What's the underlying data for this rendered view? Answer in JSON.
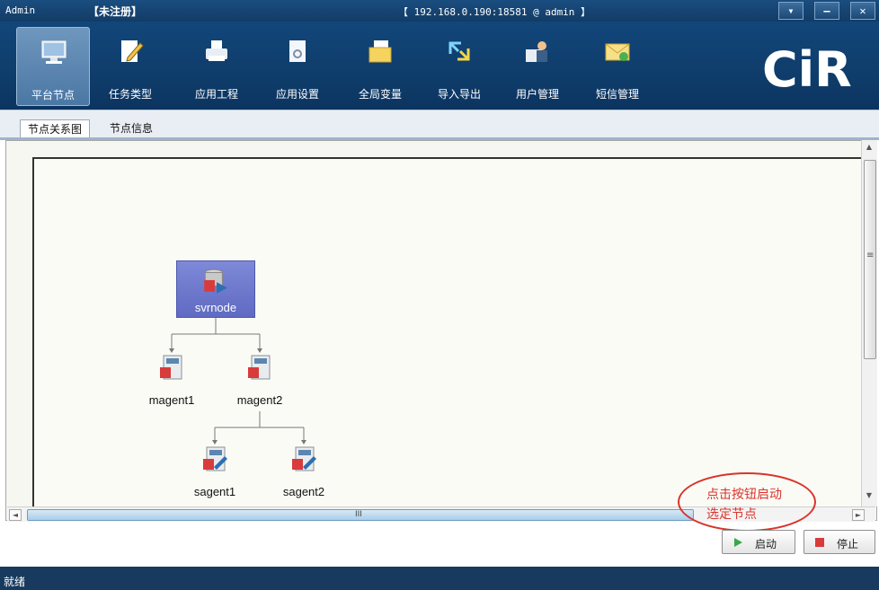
{
  "titlebar": {
    "user": "Admin",
    "registration": "【未注册】",
    "host": "【 192.168.0.190:18581 @ admin 】",
    "buttons": [
      "▾",
      "–",
      "✕"
    ]
  },
  "toolbar": {
    "items": [
      {
        "label": "平台节点",
        "icon": "monitor-icon",
        "active": true
      },
      {
        "label": "任务类型",
        "icon": "edit-document-icon",
        "active": false
      },
      {
        "label": "应用工程",
        "icon": "printer-icon",
        "active": false
      },
      {
        "label": "应用设置",
        "icon": "settings-document-icon",
        "active": false
      },
      {
        "label": "全局变量",
        "icon": "folder-document-icon",
        "active": false
      },
      {
        "label": "导入导出",
        "icon": "import-export-arrows-icon",
        "active": false
      },
      {
        "label": "用户管理",
        "icon": "user-management-icon",
        "active": false
      },
      {
        "label": "短信管理",
        "icon": "sms-envelope-icon",
        "active": false
      }
    ],
    "logo_text": "CiR"
  },
  "tabs": [
    {
      "label": "节点关系图",
      "active": true
    },
    {
      "label": "节点信息",
      "active": false
    }
  ],
  "graph": {
    "root": "svrnode",
    "level1": [
      "magent1",
      "magent2"
    ],
    "level2": [
      "sagent1",
      "sagent2"
    ]
  },
  "annotation": {
    "line1": "点击按钮启动",
    "line2": "选定节点"
  },
  "actions": {
    "start_label": "启动",
    "stop_label": "停止"
  },
  "scroll": {
    "h_thumb_grip": "III",
    "v_thumb_grip": "≡"
  },
  "status": {
    "text": "就绪"
  },
  "colors": {
    "toolbar_bg": "#0f3d6b",
    "status_bg": "#173a5e",
    "annotation": "#d9342b",
    "selected_node": "#6f79cd"
  }
}
